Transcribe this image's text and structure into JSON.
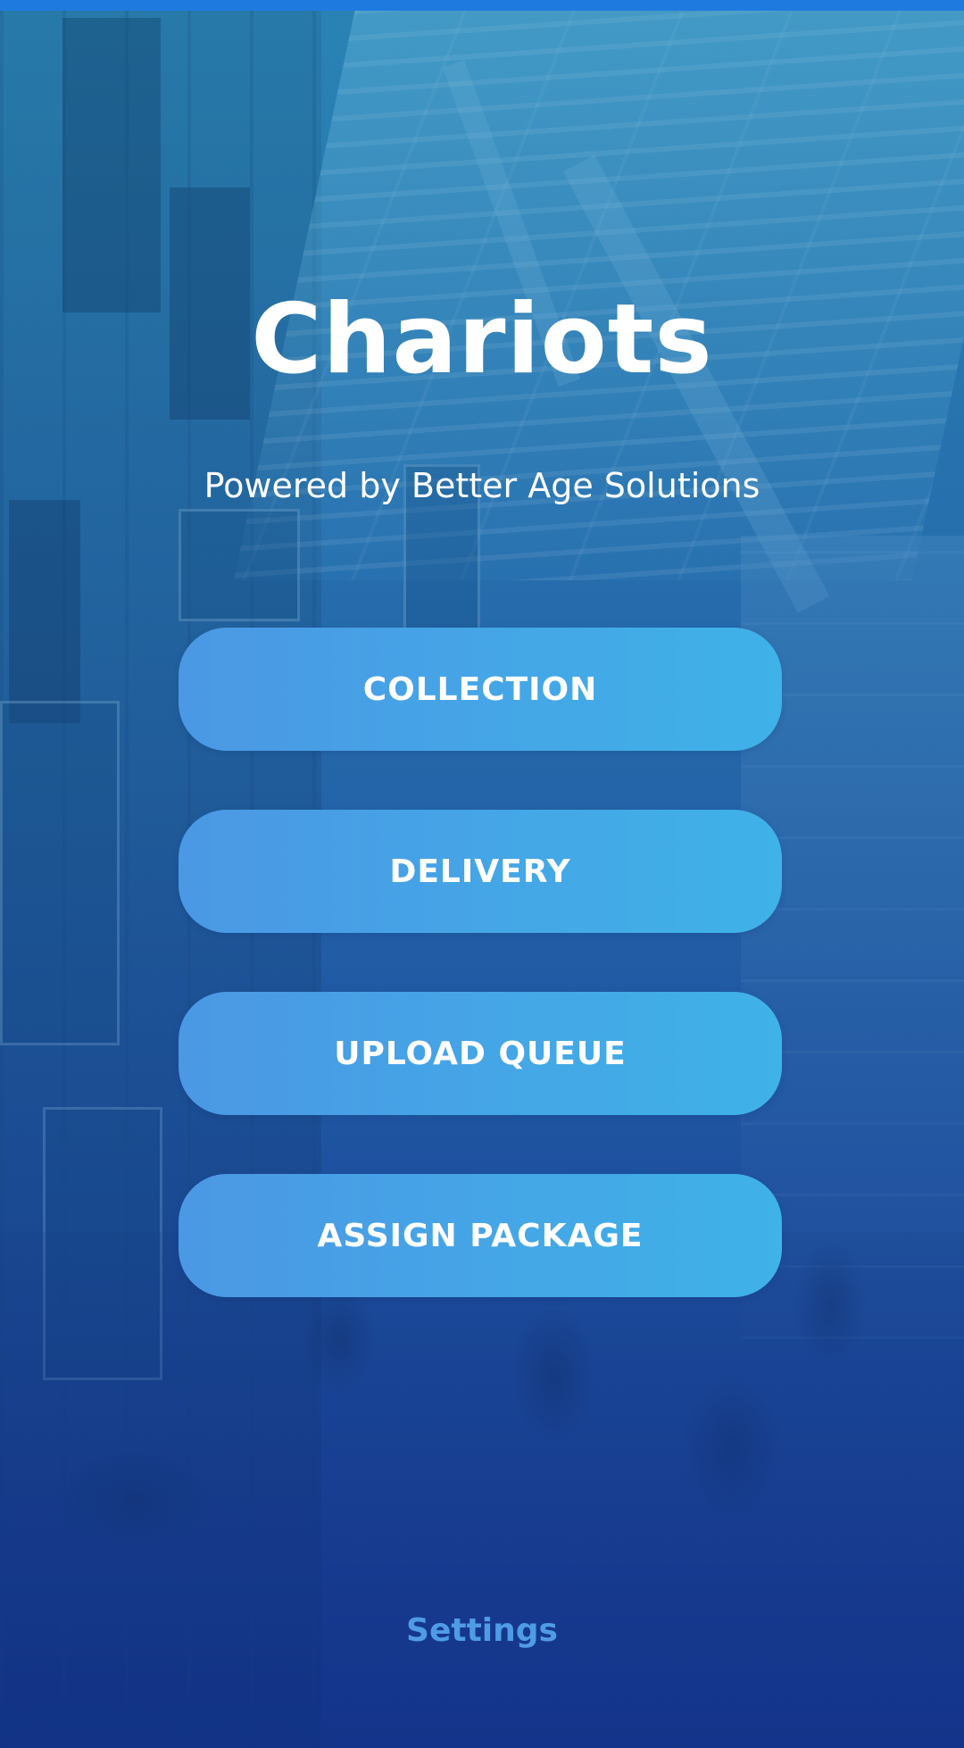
{
  "app": {
    "title": "Chariots",
    "subtitle": "Powered by Better Age Solutions"
  },
  "menu": {
    "items": [
      {
        "label": "COLLECTION"
      },
      {
        "label": "DELIVERY"
      },
      {
        "label": "UPLOAD QUEUE"
      },
      {
        "label": "ASSIGN PACKAGE"
      }
    ]
  },
  "footer": {
    "settings_label": "Settings"
  },
  "colors": {
    "status_strip": "#1f7ae0",
    "button_gradient_start": "#4b98e4",
    "button_gradient_end": "#3fb2e8",
    "settings_text": "#4f9be6",
    "title_text": "#ffffff"
  }
}
